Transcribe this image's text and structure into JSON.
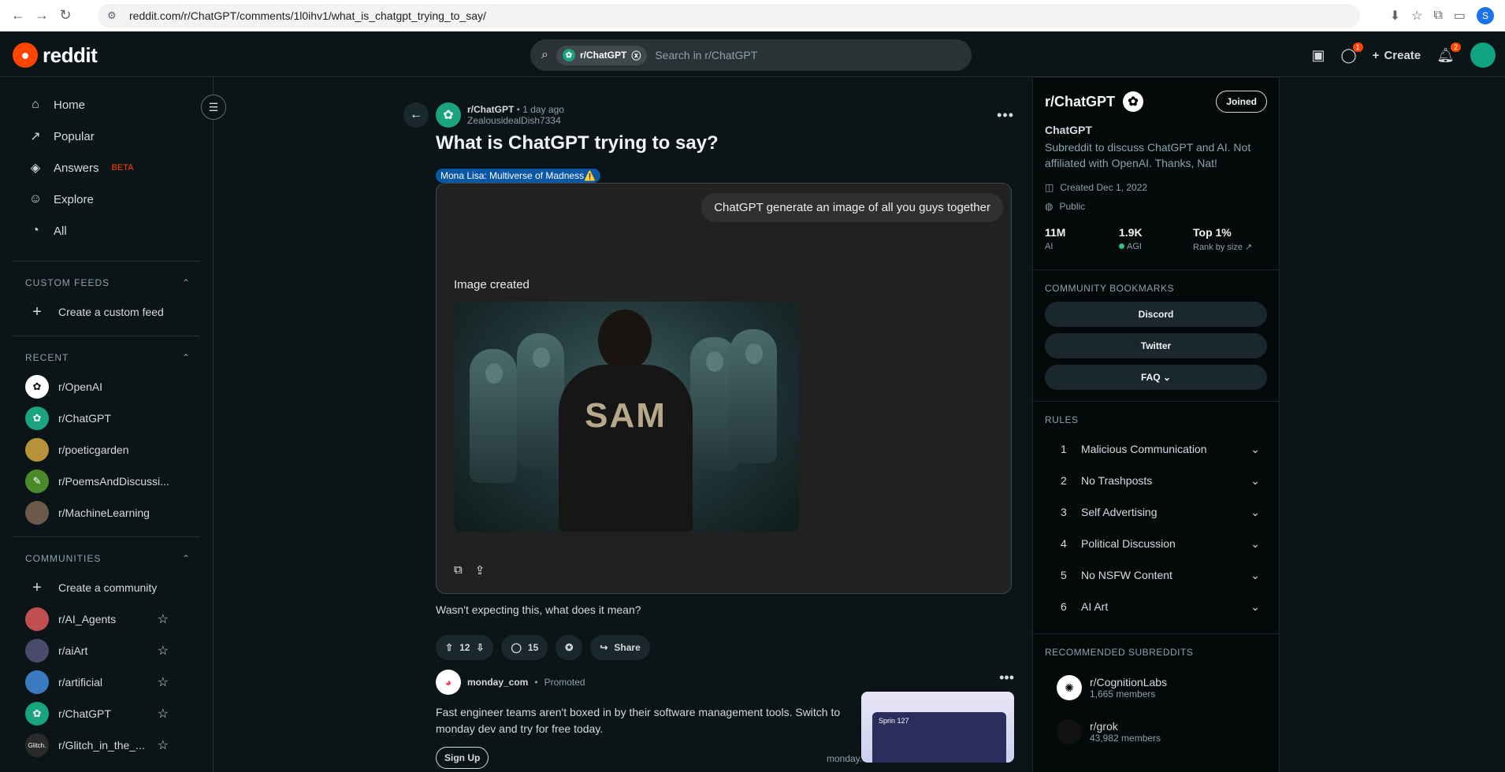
{
  "browser": {
    "url": "reddit.com/r/ChatGPT/comments/1l0ihv1/what_is_chatgpt_trying_to_say/",
    "profile_initial": "S"
  },
  "header": {
    "logo_text": "reddit",
    "search_chip": "r/ChatGPT",
    "search_placeholder": "Search in r/ChatGPT",
    "create_label": "Create",
    "chat_badge": "1",
    "notif_badge": "2"
  },
  "sidebar": {
    "nav": [
      {
        "label": "Home",
        "icon": "home-icon"
      },
      {
        "label": "Popular",
        "icon": "popular-icon"
      },
      {
        "label": "Answers",
        "icon": "answers-icon",
        "badge": "BETA"
      },
      {
        "label": "Explore",
        "icon": "explore-icon"
      },
      {
        "label": "All",
        "icon": "all-icon"
      }
    ],
    "custom_feeds_header": "CUSTOM FEEDS",
    "create_feed": "Create a custom feed",
    "recent_header": "RECENT",
    "recent": [
      {
        "label": "r/OpenAI",
        "color": "#ffffff"
      },
      {
        "label": "r/ChatGPT",
        "color": "#19a37f"
      },
      {
        "label": "r/poeticgarden",
        "color": "#b8923a"
      },
      {
        "label": "r/PoemsAndDiscussi...",
        "color": "#4a8a2a"
      },
      {
        "label": "r/MachineLearning",
        "color": "#6b5a4a"
      }
    ],
    "communities_header": "COMMUNITIES",
    "create_community": "Create a community",
    "communities": [
      {
        "label": "r/AI_Agents",
        "color": "#c05050"
      },
      {
        "label": "r/aiArt",
        "color": "#4a4a6a"
      },
      {
        "label": "r/artificial",
        "color": "#3a7ac0"
      },
      {
        "label": "r/ChatGPT",
        "color": "#19a37f"
      },
      {
        "label": "r/Glitch_in_the_...",
        "color": "#2a2a2a",
        "avatar_text": "Glitch."
      }
    ]
  },
  "post": {
    "subreddit": "r/ChatGPT",
    "time": "1 day ago",
    "author": "ZealousidealDish7334",
    "title": "What is ChatGPT trying to say?",
    "flair": "Mona Lisa: Multiverse of Madness⚠️",
    "prompt_bubble": "ChatGPT generate an image of all you guys together",
    "image_created": "Image created",
    "image_text": "SAM",
    "body": "Wasn't expecting this, what does it mean?",
    "votes": "12",
    "comments": "15",
    "share": "Share"
  },
  "ad": {
    "advertiser": "monday_com",
    "promoted": "Promoted",
    "text": "Fast engineer teams aren't boxed in by their software management tools. Switch to monday dev and try for free today.",
    "cta": "Sign Up",
    "domain": "monday.com",
    "thumb_label": "Sprin 127"
  },
  "community": {
    "name": "r/ChatGPT",
    "joined": "Joined",
    "display_name": "ChatGPT",
    "description": "Subreddit to discuss ChatGPT and AI. Not affiliated with OpenAI. Thanks, Nat!",
    "created": "Created Dec 1, 2022",
    "visibility": "Public",
    "stats": [
      {
        "value": "11M",
        "label": "AI"
      },
      {
        "value": "1.9K",
        "label": "AGI"
      },
      {
        "value": "Top 1%",
        "label": "Rank by size"
      }
    ],
    "bookmarks_header": "COMMUNITY BOOKMARKS",
    "bookmarks": [
      "Discord",
      "Twitter",
      "FAQ"
    ],
    "rules_header": "RULES",
    "rules": [
      {
        "n": "1",
        "t": "Malicious Communication"
      },
      {
        "n": "2",
        "t": "No Trashposts"
      },
      {
        "n": "3",
        "t": "Self Advertising"
      },
      {
        "n": "4",
        "t": "Political Discussion"
      },
      {
        "n": "5",
        "t": "No NSFW Content"
      },
      {
        "n": "6",
        "t": "AI Art"
      }
    ],
    "recommended_header": "RECOMMENDED SUBREDDITS",
    "recommended": [
      {
        "name": "r/CognitionLabs",
        "members": "1,665 members"
      },
      {
        "name": "r/grok",
        "members": "43,982 members"
      }
    ]
  }
}
